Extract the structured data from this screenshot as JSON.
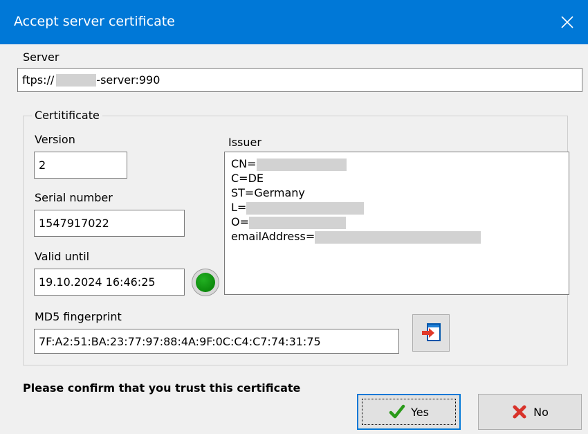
{
  "window": {
    "title": "Accept server certificate"
  },
  "server": {
    "label": "Server",
    "value_prefix": "ftps://",
    "value_suffix": "-server:990"
  },
  "certificate": {
    "group_label": "Certitificate",
    "version": {
      "label": "Version",
      "value": "2"
    },
    "serial": {
      "label": "Serial number",
      "value": "1547917022"
    },
    "valid_until": {
      "label": "Valid until",
      "value": "19.10.2024 16:46:25",
      "status_color": "#0c8a0c"
    },
    "issuer": {
      "label": "Issuer",
      "lines": [
        "CN=",
        "C=DE",
        "ST=Germany",
        "L=",
        "O=",
        "emailAddress="
      ]
    },
    "md5": {
      "label": "MD5 fingerprint",
      "value": "7F:A2:51:BA:23:77:97:88:4A:9F:0C:C4:C7:74:31:75"
    }
  },
  "confirm_text": "Please confirm that you trust this certificate",
  "buttons": {
    "yes": "Yes",
    "no": "No"
  },
  "icons": {
    "close": "close-icon",
    "copy": "copy-to-clipboard-icon",
    "yes": "checkmark-icon",
    "no": "red-x-icon"
  },
  "colors": {
    "titlebar": "#0078d7",
    "accent": "#0078d7",
    "ok_green": "#0c8a0c"
  }
}
